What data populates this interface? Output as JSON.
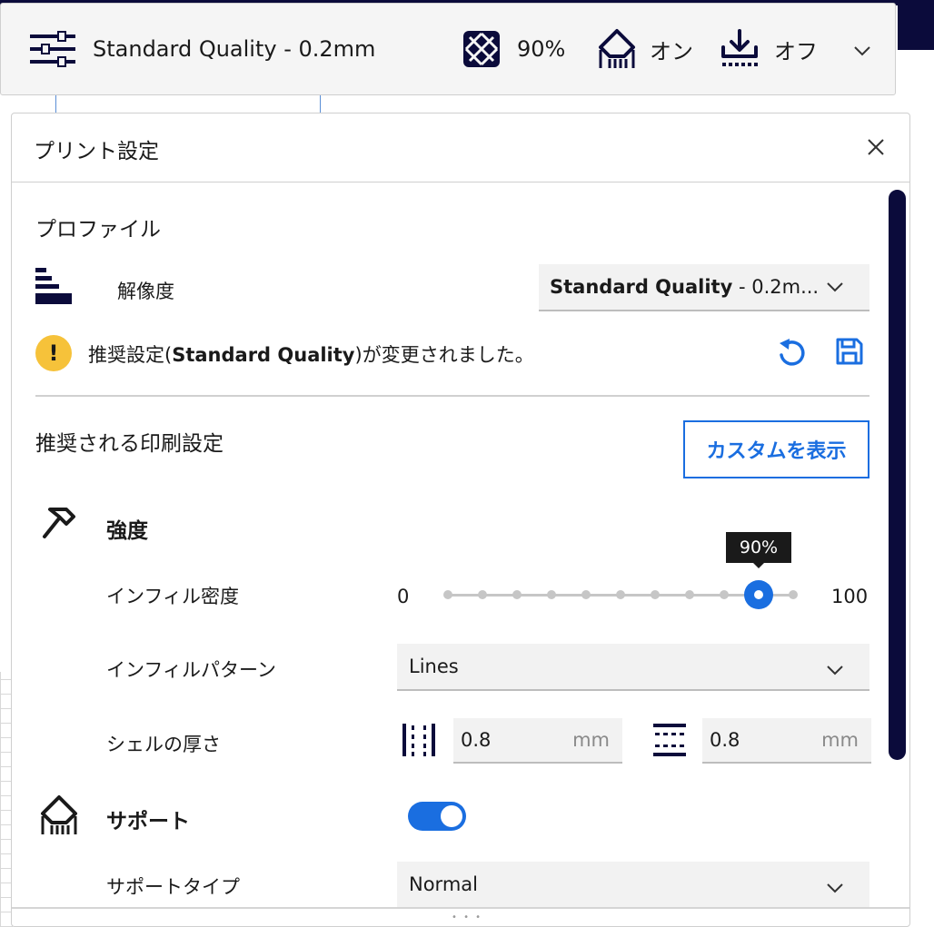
{
  "header": {
    "profile": "Standard Quality - 0.2mm",
    "infill": "90%",
    "support": "オン",
    "adhesion": "オフ"
  },
  "panel": {
    "title": "プリント設定",
    "profile_section": "プロファイル",
    "resolution_label": "解像度",
    "profile_select": {
      "bold": "Standard Quality",
      "rest": " - 0.2m..."
    },
    "warning": {
      "icon": "!",
      "prefix": "推奨設定(",
      "bold": "Standard Quality",
      "suffix": ")が変更されました。"
    },
    "recommended_title": "推奨される印刷設定",
    "custom_button": "カスタムを表示",
    "strength": {
      "title": "強度",
      "infill_density_label": "インフィル密度",
      "slider_min": "0",
      "slider_max": "100",
      "slider_value": 90,
      "slider_tooltip": "90%",
      "infill_pattern_label": "インフィルパターン",
      "infill_pattern_value": "Lines",
      "shell_thickness_label": "シェルの厚さ",
      "wall_value": "0.8",
      "wall_unit": "mm",
      "topbottom_value": "0.8",
      "topbottom_unit": "mm"
    },
    "support": {
      "title": "サポート",
      "enabled": true,
      "type_label": "サポートタイプ",
      "type_value": "Normal"
    }
  },
  "colors": {
    "accent": "#1a6ee0",
    "dark": "#0b0b3b",
    "warning": "#f6c23a"
  }
}
